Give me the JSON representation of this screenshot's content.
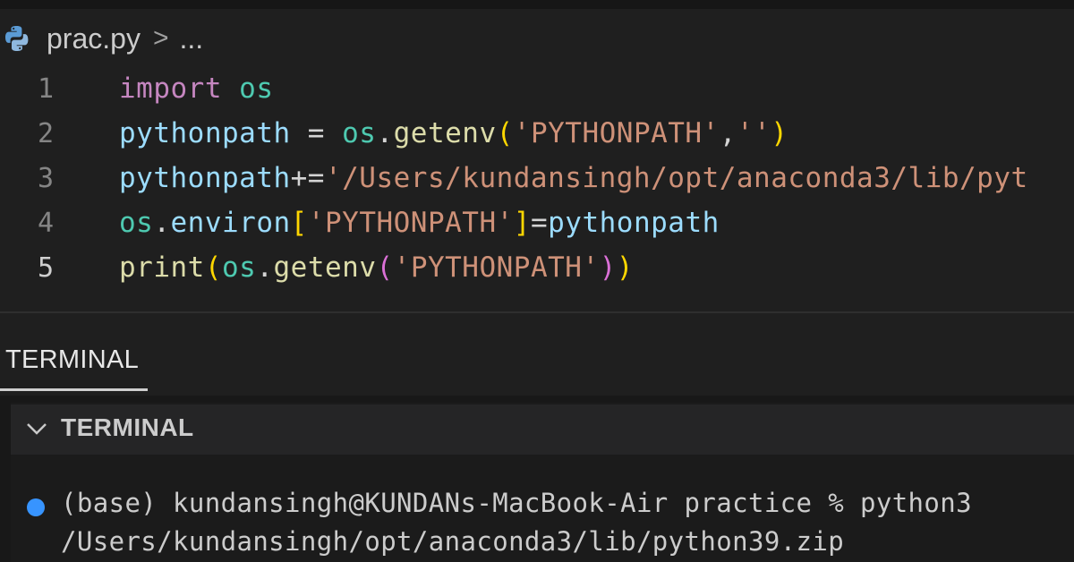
{
  "breadcrumb": {
    "file": "prac.py",
    "separator": ">",
    "ellipsis": "..."
  },
  "editor": {
    "active_line": 5,
    "lines": [
      {
        "number": "1",
        "tokens": [
          {
            "t": "import",
            "c": "kw"
          },
          {
            "t": " ",
            "c": "op"
          },
          {
            "t": "os",
            "c": "mod"
          }
        ]
      },
      {
        "number": "2",
        "tokens": [
          {
            "t": "pythonpath",
            "c": "var"
          },
          {
            "t": " = ",
            "c": "op"
          },
          {
            "t": "os",
            "c": "mod"
          },
          {
            "t": ".",
            "c": "op"
          },
          {
            "t": "getenv",
            "c": "fn"
          },
          {
            "t": "(",
            "c": "br1"
          },
          {
            "t": "'PYTHONPATH'",
            "c": "str"
          },
          {
            "t": ",",
            "c": "op"
          },
          {
            "t": "''",
            "c": "str"
          },
          {
            "t": ")",
            "c": "br1"
          }
        ]
      },
      {
        "number": "3",
        "tokens": [
          {
            "t": "pythonpath",
            "c": "var"
          },
          {
            "t": "+=",
            "c": "op"
          },
          {
            "t": "'/Users/kundansingh/opt/anaconda3/lib/pyt",
            "c": "str"
          }
        ]
      },
      {
        "number": "4",
        "tokens": [
          {
            "t": "os",
            "c": "mod"
          },
          {
            "t": ".",
            "c": "op"
          },
          {
            "t": "environ",
            "c": "var"
          },
          {
            "t": "[",
            "c": "br1"
          },
          {
            "t": "'PYTHONPATH'",
            "c": "str"
          },
          {
            "t": "]",
            "c": "br1"
          },
          {
            "t": "=",
            "c": "op"
          },
          {
            "t": "pythonpath",
            "c": "var"
          }
        ]
      },
      {
        "number": "5",
        "tokens": [
          {
            "t": "print",
            "c": "fn"
          },
          {
            "t": "(",
            "c": "br1"
          },
          {
            "t": "os",
            "c": "mod"
          },
          {
            "t": ".",
            "c": "op"
          },
          {
            "t": "getenv",
            "c": "fn"
          },
          {
            "t": "(",
            "c": "br2"
          },
          {
            "t": "'PYTHONPATH'",
            "c": "str"
          },
          {
            "t": ")",
            "c": "br2"
          },
          {
            "t": ")",
            "c": "br1"
          }
        ]
      }
    ]
  },
  "panel": {
    "tab_label": "TERMINAL",
    "section_title": "TERMINAL"
  },
  "terminal": {
    "lines": [
      "(base) kundansingh@KUNDANs-MacBook-Air practice % python3",
      "/Users/kundansingh/opt/anaconda3/lib/python39.zip"
    ]
  },
  "colors": {
    "background": "#1f1f1f",
    "keyword": "#c586c0",
    "module": "#4ec9b0",
    "variable": "#9cdcfe",
    "function": "#dcdcaa",
    "string": "#ce9178",
    "bracket_1": "#ffd700",
    "bracket_2": "#da70d6",
    "status_dot": "#3794ff"
  },
  "icons": {
    "file_icon": "python-icon",
    "section_toggle": "chevron-down-icon",
    "status": "status-dot-icon"
  }
}
